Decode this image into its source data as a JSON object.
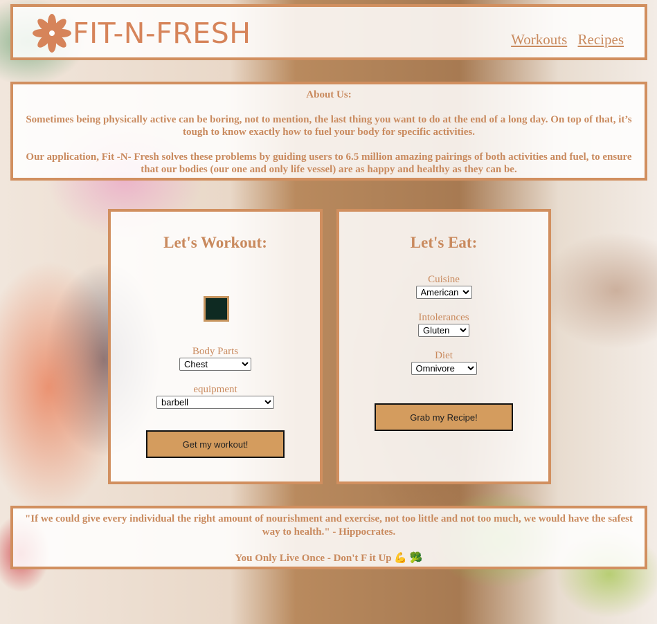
{
  "header": {
    "logo_text": "FIT-N-FRESH",
    "logo_icon": "flower-icon",
    "nav": {
      "workouts": "Workouts",
      "recipes": "Recipes"
    }
  },
  "about": {
    "title": "About Us:",
    "paragraph1": "Sometimes being physically active can be boring, not to mention, the last thing you want to do at the end of a long day. On top of that, it’s tough to know exactly how to fuel your body for specific activities.",
    "paragraph2": "Our application, Fit -N- Fresh solves these problems by guiding users to 6.5 million amazing pairings of both activities and fuel, to ensure that our bodies (our one and only life vessel) are as happy and healthy as they can be."
  },
  "workout": {
    "title": "Let's Workout:",
    "body_parts_label": "Body Parts",
    "body_parts_value": "Chest",
    "equipment_label": "equipment",
    "equipment_value": "barbell",
    "button": "Get my workout!"
  },
  "eat": {
    "title": "Let's Eat:",
    "cuisine_label": "Cuisine",
    "cuisine_value": "American",
    "intolerances_label": "Intolerances",
    "intolerances_value": "Gluten",
    "diet_label": "Diet",
    "diet_value": "Omnivore",
    "button": "Grab my Recipe!"
  },
  "footer": {
    "quote": "\"If we could give every individual the right amount of nourishment and exercise, not too little and not too much, we would have the safest way to health.\" - Hippocrates.",
    "tagline": "You Only Live Once - Don't F it Up 💪 🥦"
  },
  "colors": {
    "accent": "#d18f5f",
    "text": "#c98a5e",
    "button": "#d49c5e",
    "swatch": "#0e2a22"
  }
}
